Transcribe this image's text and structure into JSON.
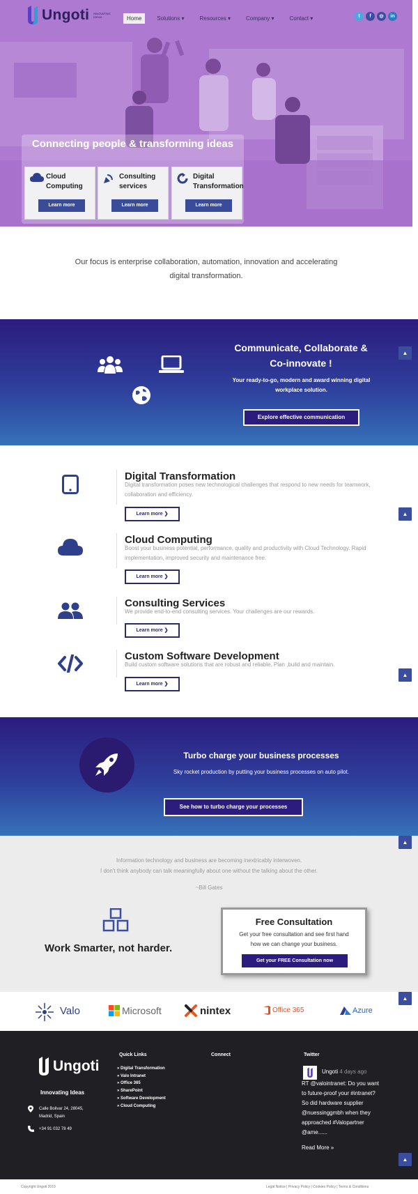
{
  "header": {
    "brand": "Ungoti",
    "tagline": "INNOVATING IDEAS",
    "nav": [
      {
        "label": "Home"
      },
      {
        "label": "Solutions ▾"
      },
      {
        "label": "Resources ▾"
      },
      {
        "label": "Company ▾"
      },
      {
        "label": "Contact ▾"
      }
    ],
    "socials": [
      {
        "icon": "twitter-icon",
        "glyph": "t",
        "color": "#4aa8e0"
      },
      {
        "icon": "facebook-icon",
        "glyph": "f",
        "color": "#3b4e9e"
      },
      {
        "icon": "instagram-icon",
        "glyph": "◎",
        "color": "#3b4e9e"
      },
      {
        "icon": "linkedin-icon",
        "glyph": "in",
        "color": "#2a7bbf"
      }
    ]
  },
  "hero": {
    "title": "Connecting people & transforming ideas",
    "cards": [
      {
        "title": "Cloud Computing",
        "icon": "cloud-icon",
        "button": "Learn more"
      },
      {
        "title": "Consulting services",
        "icon": "satellite-icon",
        "button": "Learn more"
      },
      {
        "title": "Digital Transformation",
        "icon": "refresh-icon",
        "button": "Learn more"
      }
    ]
  },
  "focus": {
    "line1": "Our focus is enterprise collaboration, automation, innovation and accelerating",
    "line2": "digital transformation."
  },
  "communicate": {
    "title_line1": "Communicate, Collaborate &",
    "title_line2": "Co-innovate !",
    "sub_line1": "Your ready-to-go, modern and award winning digital",
    "sub_line2": "workplace solution.",
    "button": "Explore effective communication"
  },
  "services": [
    {
      "title": "Digital Transformation",
      "icon": "tablet-icon",
      "desc": "Digital transformation poses new technological challenges that respond to new needs for teamwork, collaboration and efficiency.",
      "button": "Learn more ❯"
    },
    {
      "title": "Cloud Computing",
      "icon": "cloud-icon",
      "desc": "Boost your business potential, performance, quality and productivity with Cloud Technology. Rapid implementation, improved security and maintenance free.",
      "button": "Learn more ❯"
    },
    {
      "title": "Consulting Services",
      "icon": "users-icon",
      "desc": "We provide end-to-end consulting services. Your challenges are our rewards.",
      "button": "Learn more ❯"
    },
    {
      "title": "Custom Software Development",
      "icon": "code-icon",
      "desc": "Build custom software solutions that are robust and reliable. Plan ,build and maintain.",
      "button": "Learn more ❯"
    }
  ],
  "turbo": {
    "title": "Turbo charge your business processes",
    "sub": "Sky rocket production by putting your business processes on auto pilot.",
    "button": "See how to turbo charge your processes"
  },
  "quote": {
    "line1": "Information technology and business are becoming inextricably interwoven.",
    "line2": "I don't think anybody can talk meaningfully about one without the talking about the other.",
    "author": "~Bill Gates"
  },
  "work": {
    "title": "Work Smarter, not harder."
  },
  "consultation": {
    "title": "Free Consultation",
    "line1": "Get your free consultation and see first hand",
    "line2": "how we can change your business.",
    "button": "Get your FREE Consultation now"
  },
  "partners": [
    {
      "name": "Valo",
      "icon": "valo-logo"
    },
    {
      "name": "Microsoft",
      "icon": "microsoft-logo"
    },
    {
      "name": "nintex",
      "icon": "nintex-logo"
    },
    {
      "name": "Office 365",
      "icon": "office365-logo"
    },
    {
      "name": "Azure",
      "icon": "azure-logo"
    }
  ],
  "footer": {
    "brand": "Ungoti",
    "tagline": "Innovating Ideas",
    "address_line1": "Calle Bolivar 24, 28045,",
    "address_line2": "Madrid, Spain",
    "phone": "+34 91 032 78 49",
    "quick_links_title": "Quick Links",
    "quick_links": [
      "Digital Transformation",
      "Valo Intranet",
      "Office 365",
      "SharePoint",
      "Software Development",
      "Cloud Computing"
    ],
    "connect_title": "Connect",
    "twitter_title": "Twitter",
    "tweet_author": "Ungoti",
    "tweet_time": "4 days ago",
    "tweet_text": "RT @valointranet: Do you want to future-proof your #intranet? So did hardware supplier @nuessinggmbh when they approached #Valopartner @ame......",
    "read_more": "Read More »"
  },
  "bottom": {
    "copyright": "Copyright Ungoti 2019",
    "legal": "Legal Notice | Privacy Policy | Cookies Policy | Terms & Conditions"
  },
  "colors": {
    "primary": "#2c1c7e",
    "accent": "#3b4e9e",
    "footer": "#1f1f24"
  }
}
